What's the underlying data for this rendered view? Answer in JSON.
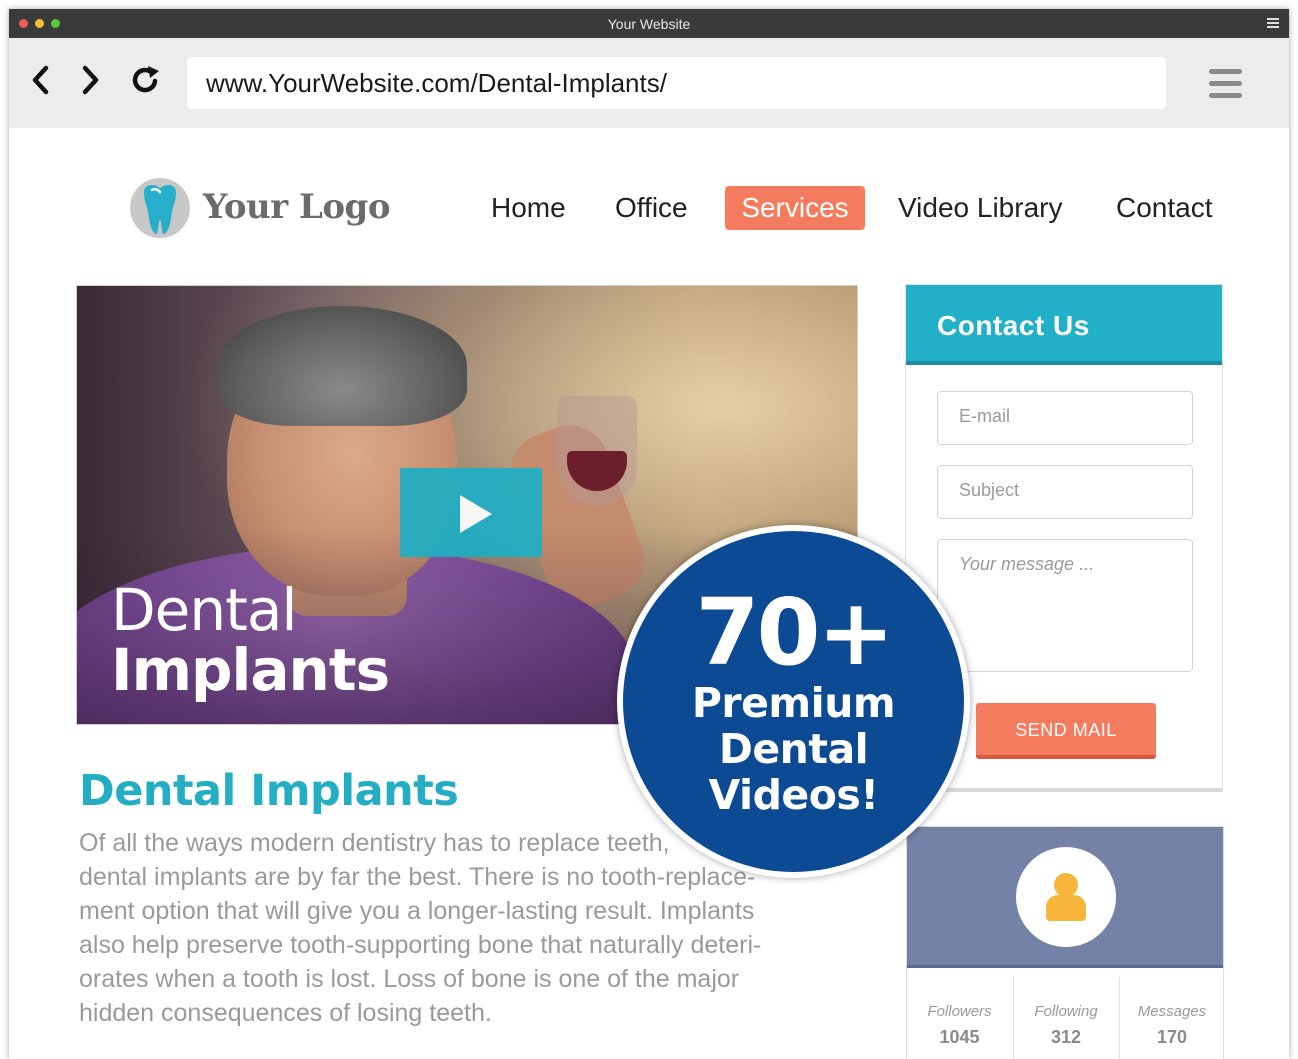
{
  "window": {
    "title": "Your Website"
  },
  "browser": {
    "url": "www.YourWebsite.com/Dental-Implants/"
  },
  "site": {
    "logo_text": "Your Logo",
    "nav": [
      {
        "label": "Home"
      },
      {
        "label": "Office"
      },
      {
        "label": "Services",
        "active": true
      },
      {
        "label": "Video Library"
      },
      {
        "label": "Contact"
      }
    ],
    "accent_color": "#f47b5d",
    "brand_color": "#22b0c8"
  },
  "video": {
    "caption_line1": "Dental",
    "caption_line2": "Implants"
  },
  "article": {
    "title": "Dental Implants",
    "body_lines": [
      "Of all the ways modern dentistry has to replace teeth,",
      "dental implants are by far the best. There is no tooth-replace-",
      "ment option that will give you a longer-lasting result. Implants",
      "also help preserve tooth-supporting bone that naturally deteri-",
      "orates when a tooth is lost. Loss of bone is one of the major",
      "hidden consequences of losing teeth."
    ]
  },
  "contact": {
    "title": "Contact Us",
    "email_placeholder": "E-mail",
    "subject_placeholder": "Subject",
    "message_placeholder": "Your message ...",
    "send_label": "SEND MAIL"
  },
  "profile": {
    "stats": [
      {
        "label": "Followers",
        "value": "1045"
      },
      {
        "label": "Following",
        "value": "312"
      },
      {
        "label": "Messages",
        "value": "170"
      }
    ]
  },
  "badge": {
    "count": "70+",
    "line1": "Premium",
    "line2": "Dental",
    "line3": "Videos!"
  }
}
